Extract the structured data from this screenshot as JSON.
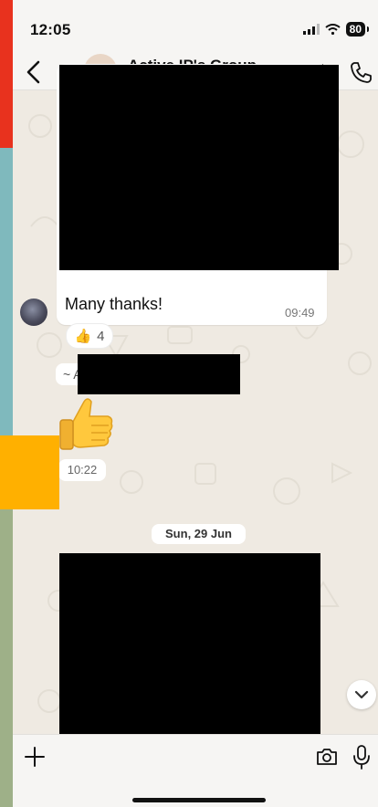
{
  "status_bar": {
    "time": "12:05",
    "battery": "80"
  },
  "header": {
    "title": "Active IP's Group"
  },
  "messages": {
    "thanks_text": "Many thanks!",
    "thanks_time": "09:49",
    "reaction_emoji": "👍",
    "reaction_count": "4",
    "sender_prefix": "~ A",
    "sticker_time": "10:22"
  },
  "date_separator": "Sun, 29 Jun",
  "colors": {
    "chat_background": "#efeae2",
    "bubble": "#ffffff",
    "edge_red": "#e8321e",
    "edge_orange": "#ffb000"
  }
}
